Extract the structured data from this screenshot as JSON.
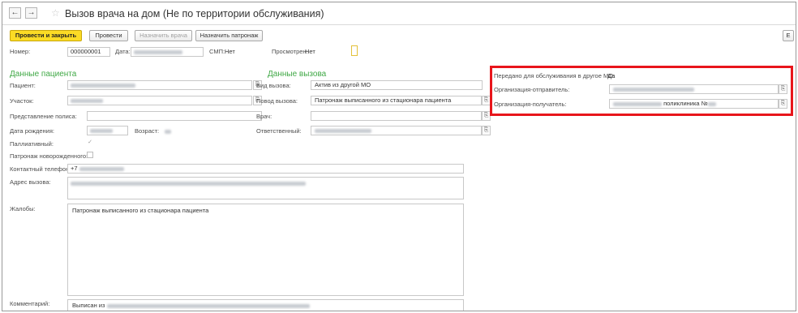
{
  "window": {
    "title": "Вызов врача на дом (Не по территории обслуживания)"
  },
  "nav": {
    "back_glyph": "←",
    "forward_glyph": "→",
    "star_glyph": "☆"
  },
  "toolbar": {
    "post_close": "Провести и закрыть",
    "post": "Провести",
    "assign_doctor": "Назначить врача",
    "assign_patronage": "Назначить патронаж",
    "more_glyph": "E"
  },
  "header": {
    "number_label": "Номер:",
    "number_value": "000000001",
    "date_label": "Дата:",
    "smp_label": "СМП:",
    "smp_value": "Нет",
    "viewed_label": "Просмотрен:",
    "viewed_value": "Нет"
  },
  "patient": {
    "section": "Данные пациента",
    "patient_label": "Пациент:",
    "district_label": "Участок:",
    "policy_label": "Представление полиса:",
    "birth_label": "Дата рождения:",
    "age_label": "Возраст:",
    "palliative_label": "Паллиативный:",
    "newborn_label": "Патронаж новорожденного:",
    "phone_label": "Контактный телефон:",
    "phone_value": "+7",
    "address_label": "Адрес вызова:",
    "complaints_label": "Жалобы:",
    "complaints_value": "Патронаж выписанного из стационара пациента",
    "comment_label": "Комментарий:",
    "comment_value": "Выписан из"
  },
  "call": {
    "section": "Данные вызова",
    "type_label": "Вид вызова:",
    "type_value": "Актив из другой МО",
    "reason_label": "Повод вызова:",
    "reason_value": "Патронаж выписанного из стационара пациента",
    "doctor_label": "Врач:",
    "responsible_label": "Ответственный:"
  },
  "transfer": {
    "label": "Передано для обслуживания в другое МО:",
    "value": "Да",
    "sender_label": "Организация-отправитель:",
    "receiver_label": "Организация-получатель:",
    "receiver_value": "поликлиника №"
  },
  "icons": {
    "pick": "⎘",
    "check": "✓"
  }
}
